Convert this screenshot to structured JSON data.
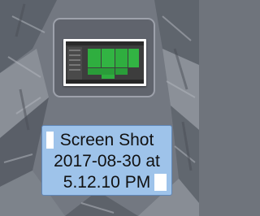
{
  "desktop": {
    "wallpaper": "gray-rock-wallpaper"
  },
  "file": {
    "icon": "screenshot-thumbnail-icon",
    "name_lines": [
      "Screen Shot",
      "2017-08-30 at",
      "5.12.10 PM"
    ],
    "selection_color": "#9ec3ea"
  }
}
